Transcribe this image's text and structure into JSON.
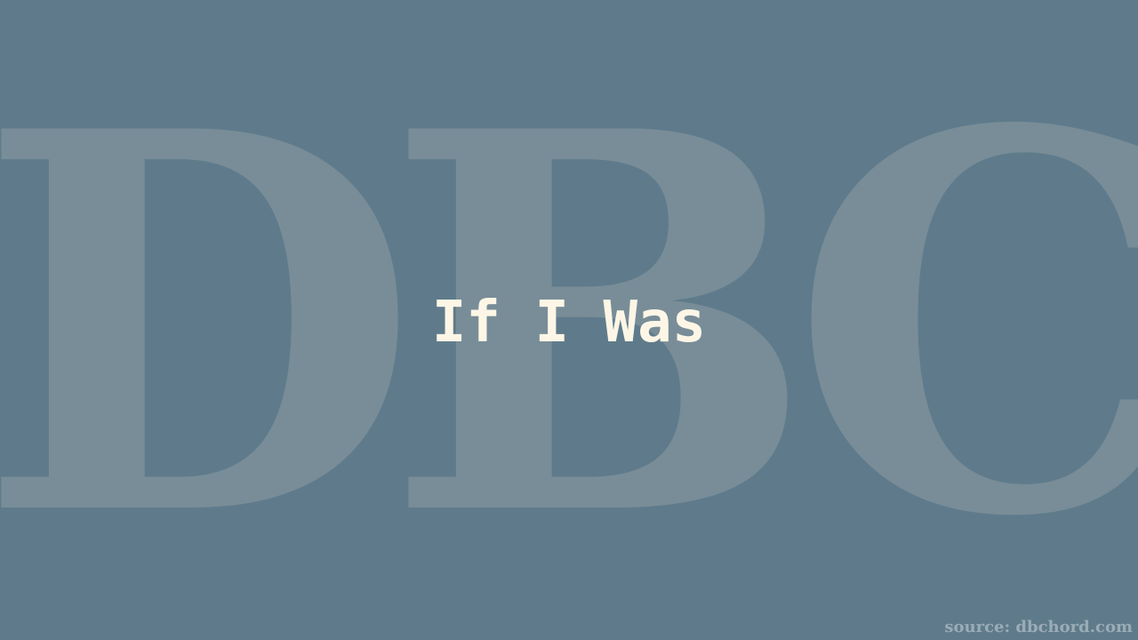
{
  "watermark": {
    "text": "DBC"
  },
  "title": {
    "text": "If I Was"
  },
  "source": {
    "text": "source: dbchord.com"
  },
  "colors": {
    "background": "#5f7b8b",
    "watermark": "#788d98",
    "title": "#fdf6e6",
    "source": "#9aacb6"
  }
}
